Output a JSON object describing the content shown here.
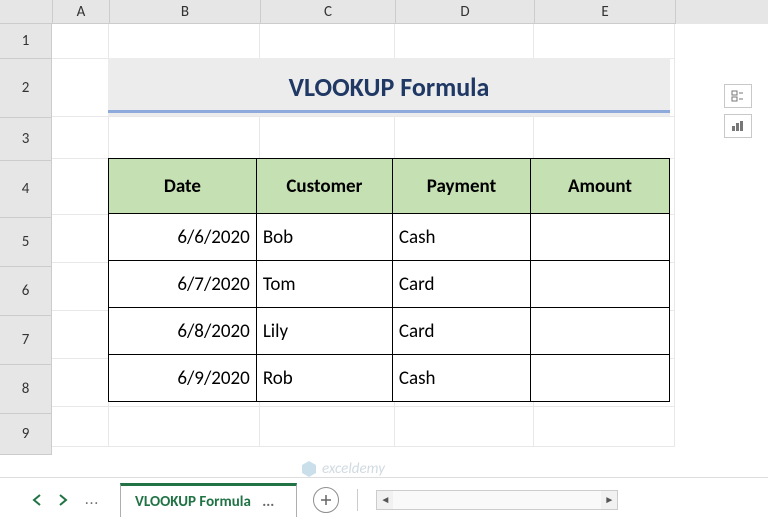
{
  "columns": [
    "A",
    "B",
    "C",
    "D",
    "E"
  ],
  "rows": [
    "1",
    "2",
    "3",
    "4",
    "5",
    "6",
    "7",
    "8",
    "9"
  ],
  "title": "VLOOKUP Formula",
  "table": {
    "headers": [
      "Date",
      "Customer",
      "Payment",
      "Amount"
    ],
    "data": [
      {
        "date": "6/6/2020",
        "customer": "Bob",
        "payment": "Cash",
        "amount": ""
      },
      {
        "date": "6/7/2020",
        "customer": "Tom",
        "payment": "Card",
        "amount": ""
      },
      {
        "date": "6/8/2020",
        "customer": "Lily",
        "payment": "Card",
        "amount": ""
      },
      {
        "date": "6/9/2020",
        "customer": "Rob",
        "payment": "Cash",
        "amount": ""
      }
    ]
  },
  "tab": {
    "active_name": "VLOOKUP Formula",
    "dots": "...",
    "nav_dots": "..."
  },
  "watermark": "exceldemy",
  "chart_data": {
    "type": "table",
    "title": "VLOOKUP Formula",
    "columns": [
      "Date",
      "Customer",
      "Payment",
      "Amount"
    ],
    "rows": [
      [
        "6/6/2020",
        "Bob",
        "Cash",
        ""
      ],
      [
        "6/7/2020",
        "Tom",
        "Card",
        ""
      ],
      [
        "6/8/2020",
        "Lily",
        "Card",
        ""
      ],
      [
        "6/9/2020",
        "Rob",
        "Cash",
        ""
      ]
    ]
  }
}
